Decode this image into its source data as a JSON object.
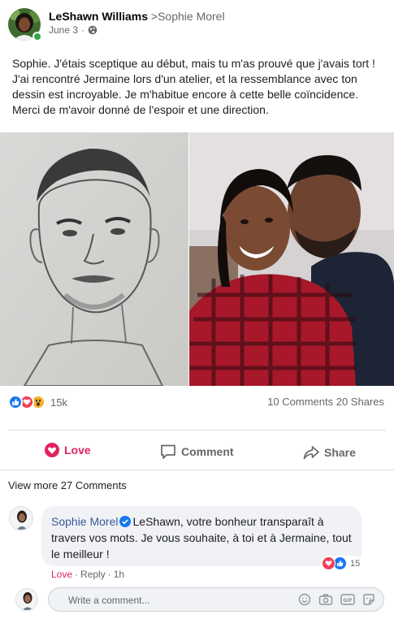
{
  "post": {
    "author": "LeShawn Williams",
    "target": ">Sophie Morel",
    "date": "June 3",
    "separator": "·",
    "privacy_icon": "globe-icon",
    "text_lines": [
      "Sophie. J'étais sceptique au début, mais tu m'as prouvé que j'avais tort !",
      "J'ai rencontré Jermaine lors d'un atelier, et la ressemblance avec ton",
      "dessin est incroyable. Je m'habitue encore à cette belle coïncidence.",
      "Merci de m'avoir donné de l'espoir et une direction."
    ],
    "photos": [
      {
        "description_icon": "pencil-sketch-portrait"
      },
      {
        "description_icon": "couple-selfie-photo"
      }
    ]
  },
  "stats": {
    "reaction_icons": [
      "like-icon",
      "love-icon",
      "wow-icon"
    ],
    "reaction_count": "15k",
    "comments": "10 Comments",
    "shares": "20 Shares"
  },
  "actions": {
    "love": "Love",
    "comment": "Comment",
    "share": "Share"
  },
  "comments_section": {
    "view_more": "View more 27 Comments",
    "comment": {
      "author": "Sophie Morel",
      "text_lines": [
        "LeShawn, votre bonheur transparaît à",
        "travers vos mots. Je vous souhaite, à toi et à Jermaine, tout",
        "le meilleur !"
      ],
      "reaction_count": "15",
      "love_link": "Love",
      "reply_link": "Reply",
      "time": "1h"
    },
    "write": {
      "placeholder": "Write a comment..."
    }
  },
  "colors": {
    "love": "#e0245e",
    "like": "#1877f2",
    "wow": "#f7b125",
    "link": "#385898",
    "muted": "#65676b"
  }
}
